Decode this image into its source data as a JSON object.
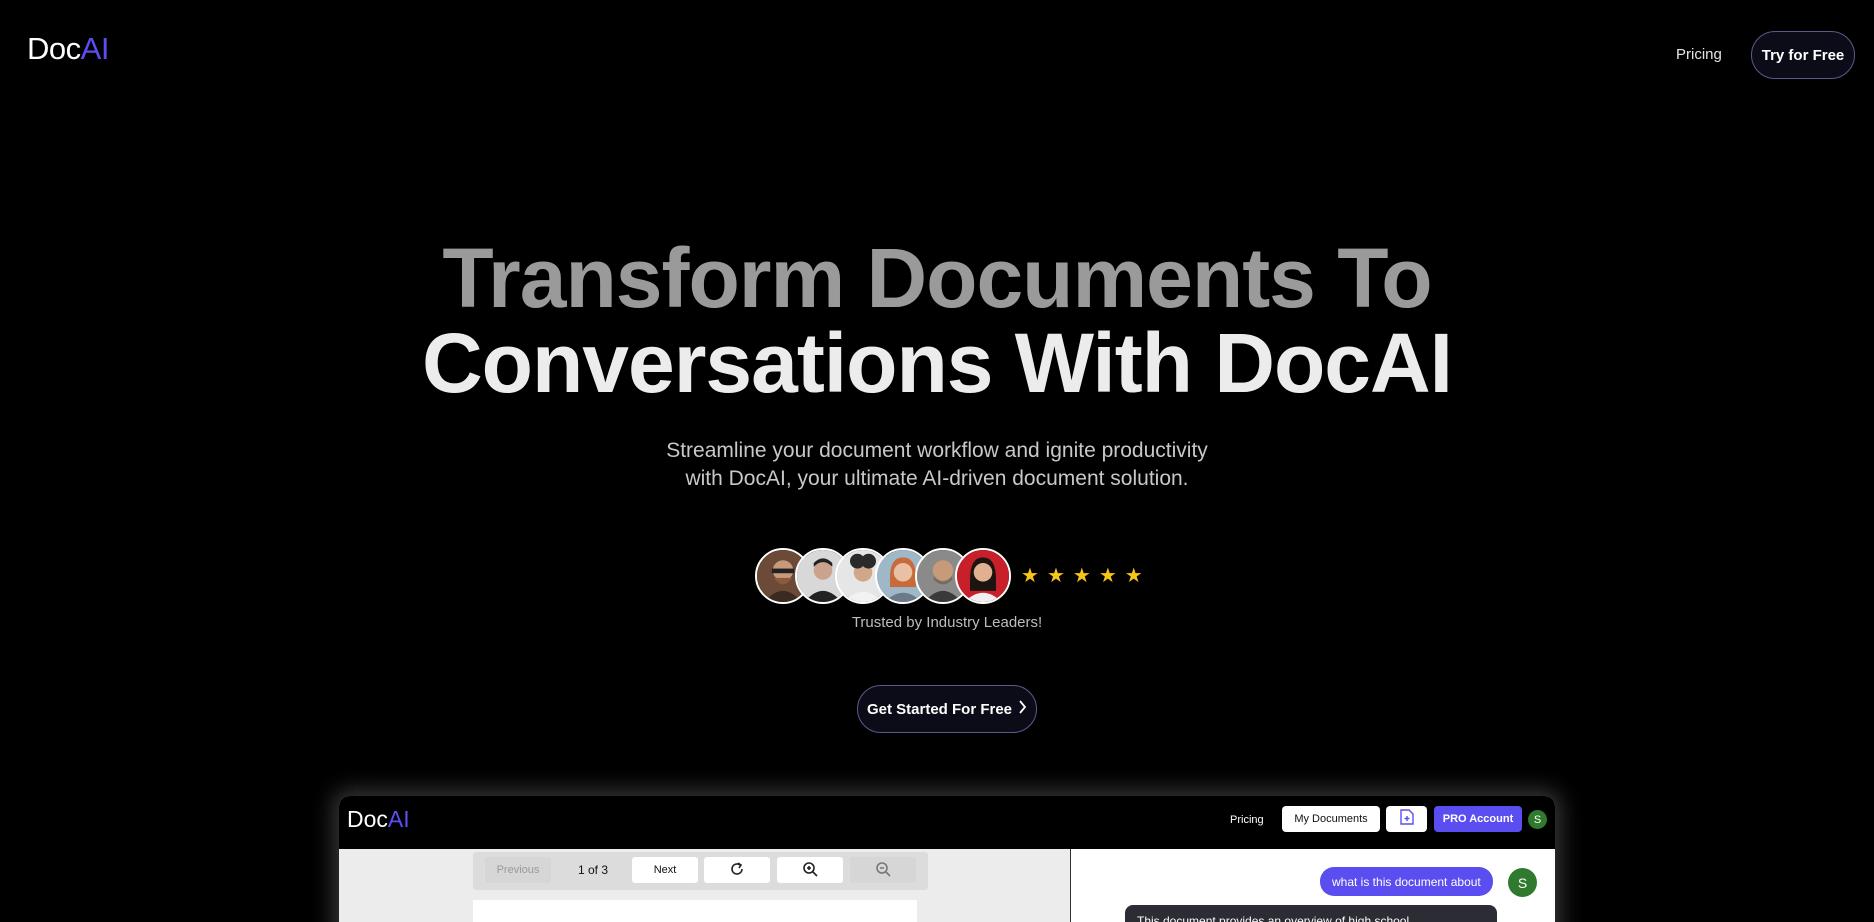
{
  "nav": {
    "logo_prefix": "Doc",
    "logo_suffix": "AI",
    "pricing": "Pricing",
    "try_label": "Try for Free"
  },
  "hero": {
    "title_line1": "Transform Documents To",
    "title_line2": "Conversations With DocAI",
    "subtitle_line1": "Streamline your document workflow and ignite productivity",
    "subtitle_line2": "with DocAI, your ultimate AI-driven document solution.",
    "rating_stars": 5,
    "trusted_text": "Trusted by Industry Leaders!",
    "cta_label": "Get Started For Free",
    "cta_icon": "chevron-right-icon"
  },
  "preview": {
    "logo_prefix": "Doc",
    "logo_suffix": "AI",
    "pricing": "Pricing",
    "my_documents": "My Documents",
    "upload_icon": "file-plus-icon",
    "pro_account": "PRO Account",
    "user_initial": "S",
    "toolbar": {
      "previous": "Previous",
      "page_indicator": "1 of 3",
      "next": "Next",
      "rotate_icon": "rotate-icon",
      "zoom_in_icon": "zoom-in-icon",
      "zoom_out_icon": "zoom-out-icon"
    },
    "chat": {
      "user_message": "what is this document about",
      "user_initial": "S",
      "bot_message": "This document provides an overview of high school"
    }
  },
  "colors": {
    "accent": "#5b4ef0",
    "background": "#000000",
    "star": "#f5c518",
    "user_avatar": "#2f7a2f"
  }
}
